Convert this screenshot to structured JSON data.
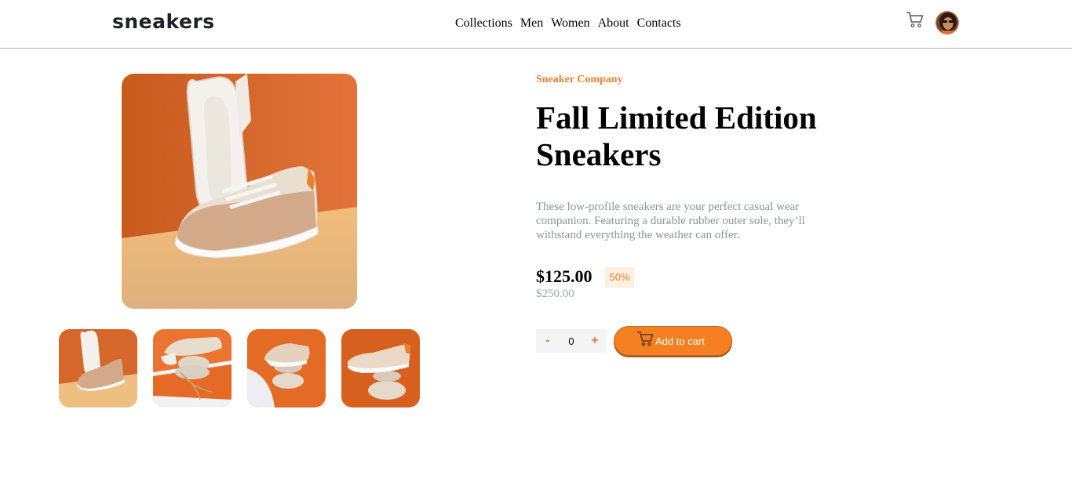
{
  "header": {
    "logo": "sneakers",
    "nav": [
      "Collections",
      "Men",
      "Women",
      "About",
      "Contacts"
    ]
  },
  "icons": {
    "cart": "cart-icon",
    "avatar": "user-avatar"
  },
  "product": {
    "company": "Sneaker Company",
    "title": "Fall Limited Edition Sneakers",
    "description": "These low-profile sneakers are your perfect casual wear companion. Featuring a durable rubber outer sole, they’ll withstand everything the weather can offer.",
    "price": "$125.00",
    "discount": "50%",
    "old_price": "$250.00"
  },
  "cart_controls": {
    "minus": "-",
    "quantity": "0",
    "plus": "+",
    "add_label": "Add to cart"
  },
  "colors": {
    "accent": "#f57f21",
    "accent_text": "#ee7e2f",
    "discount_bg": "#ffeee2",
    "muted_text": "#8e929a"
  }
}
